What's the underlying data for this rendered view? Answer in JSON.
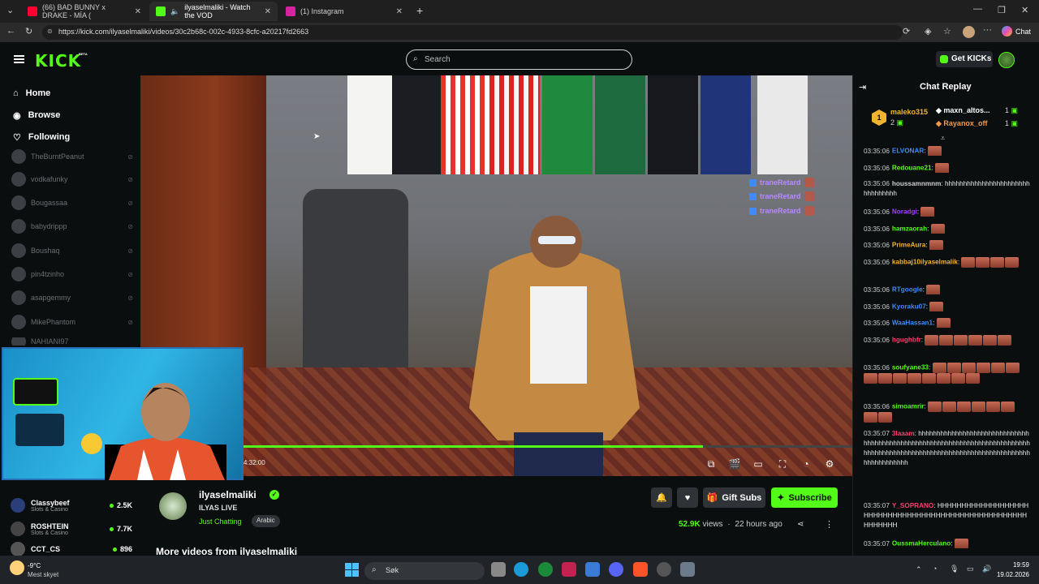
{
  "browser": {
    "tabs": [
      {
        "label": "(66) BAD BUNNY x DRAKE - MÍA (",
        "icon": "youtube-icon",
        "color": "#ff0033"
      },
      {
        "label": "ilyaselmaliki - Watch the VOD",
        "icon": "kick-icon",
        "color": "#53fc18"
      },
      {
        "label": "(1) Instagram",
        "icon": "instagram-icon",
        "color": "#d6249f"
      }
    ],
    "url": "https://kick.com/ilyaselmaliki/videos/30c2b68c-002c-4933-8cfc-a20217fd2663",
    "chat_label": "Chat"
  },
  "header": {
    "logo": "KICK",
    "beta": "BETA",
    "search_placeholder": "Search",
    "get_kicks": "Get KICKs"
  },
  "sidebar": {
    "nav": [
      {
        "label": "Home",
        "icon": "home-icon"
      },
      {
        "label": "Browse",
        "icon": "compass-icon"
      },
      {
        "label": "Following",
        "icon": "heart-icon"
      }
    ],
    "offline_channels": [
      "TheBurntPeanut",
      "vodkafunky",
      "Bougassaa",
      "babydrippp",
      "Boushaq",
      "pin4tzinho",
      "asapgemmy",
      "MikePhantom",
      "NAHIANI97"
    ],
    "live_channels": [
      {
        "name": "Classybeef",
        "category": "Slots & Casino",
        "viewers": "2.5K"
      },
      {
        "name": "ROSHTEIN",
        "category": "Slots & Casino",
        "viewers": "7.7K"
      },
      {
        "name": "CCT_CS",
        "category": "",
        "viewers": "896"
      }
    ]
  },
  "video": {
    "overlay_chat": [
      "traneRetard",
      "traneRetard",
      "traneRetard"
    ],
    "timecode": "4:32:00",
    "progress": 0.755
  },
  "stream": {
    "streamer": "ilyaselmaliki",
    "title": "ILYAS LIVE",
    "category": "Just Chatting",
    "tag": "Arabic",
    "gift_subs": "Gift Subs",
    "subscribe": "Subscribe",
    "views_count": "52.9K",
    "views_word": "views",
    "age": "22 hours ago",
    "more_videos": "More videos from ilyaselmaliki"
  },
  "chat": {
    "title": "Chat Replay",
    "leaderboard": [
      {
        "name": "maleko315",
        "count": "2"
      },
      {
        "name": "maxn_altos...",
        "count": "1"
      },
      {
        "name": "Rayanox_off",
        "count": "1"
      }
    ],
    "leader_rank": "1",
    "messages": [
      {
        "time": "03:35:06",
        "user": "ELVONAR",
        "color": "#3d8bff",
        "text": "",
        "emotes": 1
      },
      {
        "time": "03:35:06",
        "user": "Redouane21",
        "color": "#53fc18",
        "text": "",
        "emotes": 1
      },
      {
        "time": "03:35:06",
        "user": "houssamnmnm",
        "color": "#cfcfcf",
        "text": "hhhhhhhhhhhhhhhhhhhhhhhhhhhhhhhh",
        "emotes": 0
      },
      {
        "time": "03:35:06",
        "user": "Noradgi",
        "color": "#a040ff",
        "text": "",
        "emotes": 1
      },
      {
        "time": "03:35:06",
        "user": "hamzaorah",
        "color": "#53fc18",
        "text": "",
        "emotes": 1
      },
      {
        "time": "03:35:06",
        "user": "PrimeAura",
        "color": "#f2b42e",
        "text": "",
        "emotes": 1
      },
      {
        "time": "03:35:06",
        "user": "kabbaj10ilyaselmalik",
        "color": "#f2b42e",
        "text": "",
        "emotes": 4
      },
      {
        "time": "03:35:06",
        "user": "RTgoogle",
        "color": "#3d8bff",
        "text": "",
        "emotes": 1
      },
      {
        "time": "03:35:06",
        "user": "Kyoraku07",
        "color": "#3d8bff",
        "text": "",
        "emotes": 1
      },
      {
        "time": "03:35:06",
        "user": "WaaHassan1",
        "color": "#3d8bff",
        "text": "",
        "emotes": 1
      },
      {
        "time": "03:35:06",
        "user": "hgughbfr",
        "color": "#ff3c6e",
        "text": "",
        "emotes": 6
      },
      {
        "time": "03:35:06",
        "user": "soufyane33",
        "color": "#53fc18",
        "text": "",
        "emotes": 14
      },
      {
        "time": "03:35:06",
        "user": "simoamrir",
        "color": "#53fc18",
        "text": "",
        "emotes": 8
      },
      {
        "time": "03:35:07",
        "user": "3laaam",
        "color": "#ff3c6e",
        "text": "hhhhhhhhhhhhhhhhhhhhhhhhhhhhhhhhhhhhhhhhhhhhhhhhhhhhhhhhhhhhhhhhhhhhhhhhhhhhhhhhhhhhhhhhhhhhhhhhhhhhhhhhhhhhhhhhhhhhhhhhhhhhhhhhhhhh",
        "emotes": 0
      },
      {
        "time": "03:35:07",
        "user": "Y_SOPRANO",
        "color": "#ff3c6e",
        "text": "HHHHHHHHHHHHHHHHHHHHHHHHHHHHHHHHHHHHHHHHHHHHHHHHHHHHHHHHHHHH",
        "emotes": 0
      },
      {
        "time": "03:35:07",
        "user": "OussmaHerculano",
        "color": "#53fc18",
        "text": "",
        "emotes": 1
      }
    ]
  },
  "taskbar": {
    "weather_temp": "-9°C",
    "weather_desc": "Mest skyet",
    "search": "Søk",
    "time": "19:59",
    "date": "19.02.2026"
  }
}
